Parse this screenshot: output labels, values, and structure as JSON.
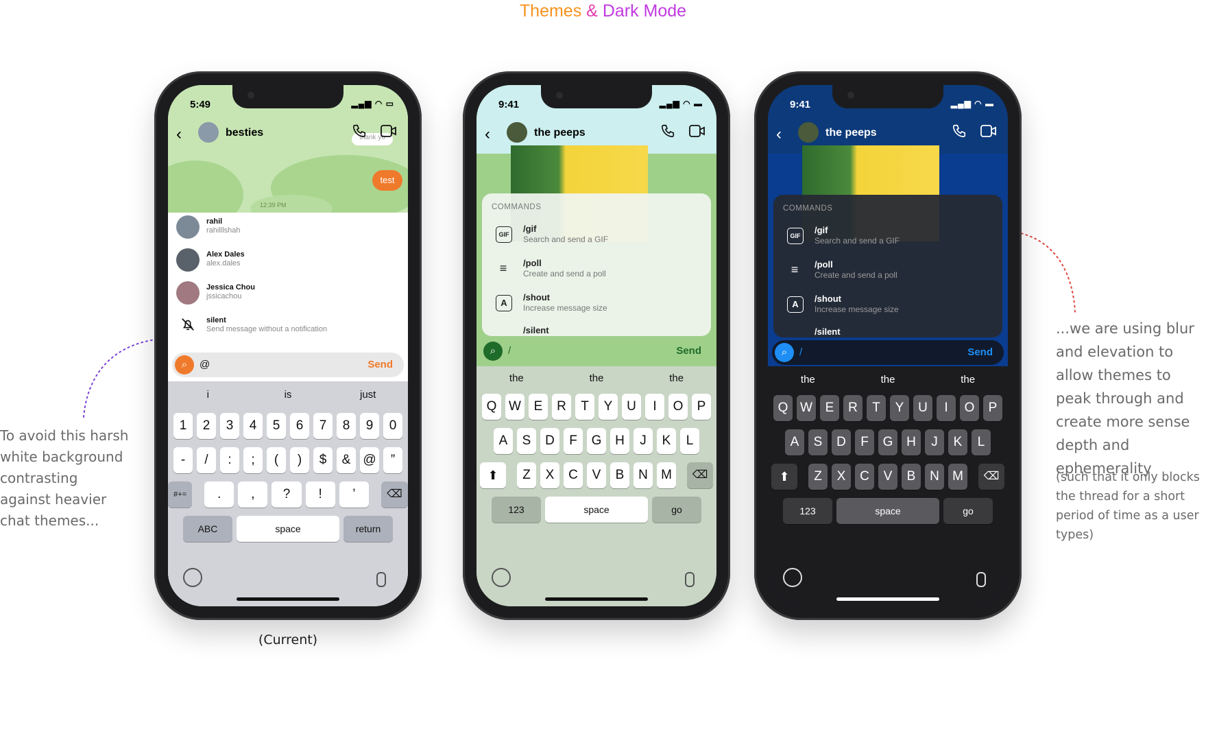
{
  "title": {
    "part1": "Themes",
    "part2": "&",
    "part3": "Dark Mode"
  },
  "notes": {
    "left": "To avoid this harsh white background contrasting against heavier chat themes...",
    "right": "...we are using blur and elevation to allow themes to peak through and create more sense depth and ephemerality",
    "right_sub": "(such that it only blocks the thread for a short period of time as a user types)",
    "caption": "(Current)"
  },
  "phone1": {
    "time": "5:49",
    "chat_name": "besties",
    "bubble_top": "thank yo",
    "bubble": "test",
    "timestamp": "12:39 PM",
    "mentions": [
      {
        "name": "rahil",
        "handle": "rahilllshah"
      },
      {
        "name": "Alex Dales",
        "handle": "alex.dales"
      },
      {
        "name": "Jessica Chou",
        "handle": "jssicachou"
      },
      {
        "name": "silent",
        "handle": "Send message without a notification"
      }
    ],
    "input_value": "@",
    "send": "Send",
    "suggestions": [
      "i",
      "is",
      "just"
    ],
    "rows": [
      [
        "1",
        "2",
        "3",
        "4",
        "5",
        "6",
        "7",
        "8",
        "9",
        "0"
      ],
      [
        "-",
        "/",
        ":",
        ";",
        "(",
        ")",
        "$",
        "&",
        "@",
        "”"
      ],
      [
        ".",
        ",",
        "?",
        "!",
        "’"
      ]
    ],
    "sym_key": "#+=",
    "abc_key": "ABC",
    "space_key": "space",
    "return_key": "return",
    "accent": "#f07a2b"
  },
  "phone2": {
    "time": "9:41",
    "chat_name": "the peeps",
    "commands_header": "COMMANDS",
    "commands": [
      {
        "name": "/gif",
        "desc": "Search and send a GIF",
        "icon": "GIF"
      },
      {
        "name": "/poll",
        "desc": "Create and send a poll",
        "icon": "≡"
      },
      {
        "name": "/shout",
        "desc": "Increase message size",
        "icon": "A"
      },
      {
        "name": "/silent",
        "desc": "",
        "icon": ""
      }
    ],
    "input_value": "/",
    "send": "Send",
    "suggestions": [
      "the",
      "the",
      "the"
    ],
    "rows": [
      [
        "Q",
        "W",
        "E",
        "R",
        "T",
        "Y",
        "U",
        "I",
        "O",
        "P"
      ],
      [
        "A",
        "S",
        "D",
        "F",
        "G",
        "H",
        "J",
        "K",
        "L"
      ],
      [
        "Z",
        "X",
        "C",
        "V",
        "B",
        "N",
        "M"
      ]
    ],
    "num_key": "123",
    "space_key": "space",
    "go_key": "go",
    "accent": "#1f6b2a"
  },
  "phone3": {
    "time": "9:41",
    "chat_name": "the peeps",
    "commands_header": "COMMANDS",
    "commands": [
      {
        "name": "/gif",
        "desc": "Search and send a GIF",
        "icon": "GIF"
      },
      {
        "name": "/poll",
        "desc": "Create and send a poll",
        "icon": "≡"
      },
      {
        "name": "/shout",
        "desc": "Increase message size",
        "icon": "A"
      },
      {
        "name": "/silent",
        "desc": "",
        "icon": ""
      }
    ],
    "input_value": "/",
    "send": "Send",
    "suggestions": [
      "the",
      "the",
      "the"
    ],
    "rows": [
      [
        "Q",
        "W",
        "E",
        "R",
        "T",
        "Y",
        "U",
        "I",
        "O",
        "P"
      ],
      [
        "A",
        "S",
        "D",
        "F",
        "G",
        "H",
        "J",
        "K",
        "L"
      ],
      [
        "Z",
        "X",
        "C",
        "V",
        "B",
        "N",
        "M"
      ]
    ],
    "num_key": "123",
    "space_key": "space",
    "go_key": "go",
    "accent": "#1e8ef5"
  }
}
